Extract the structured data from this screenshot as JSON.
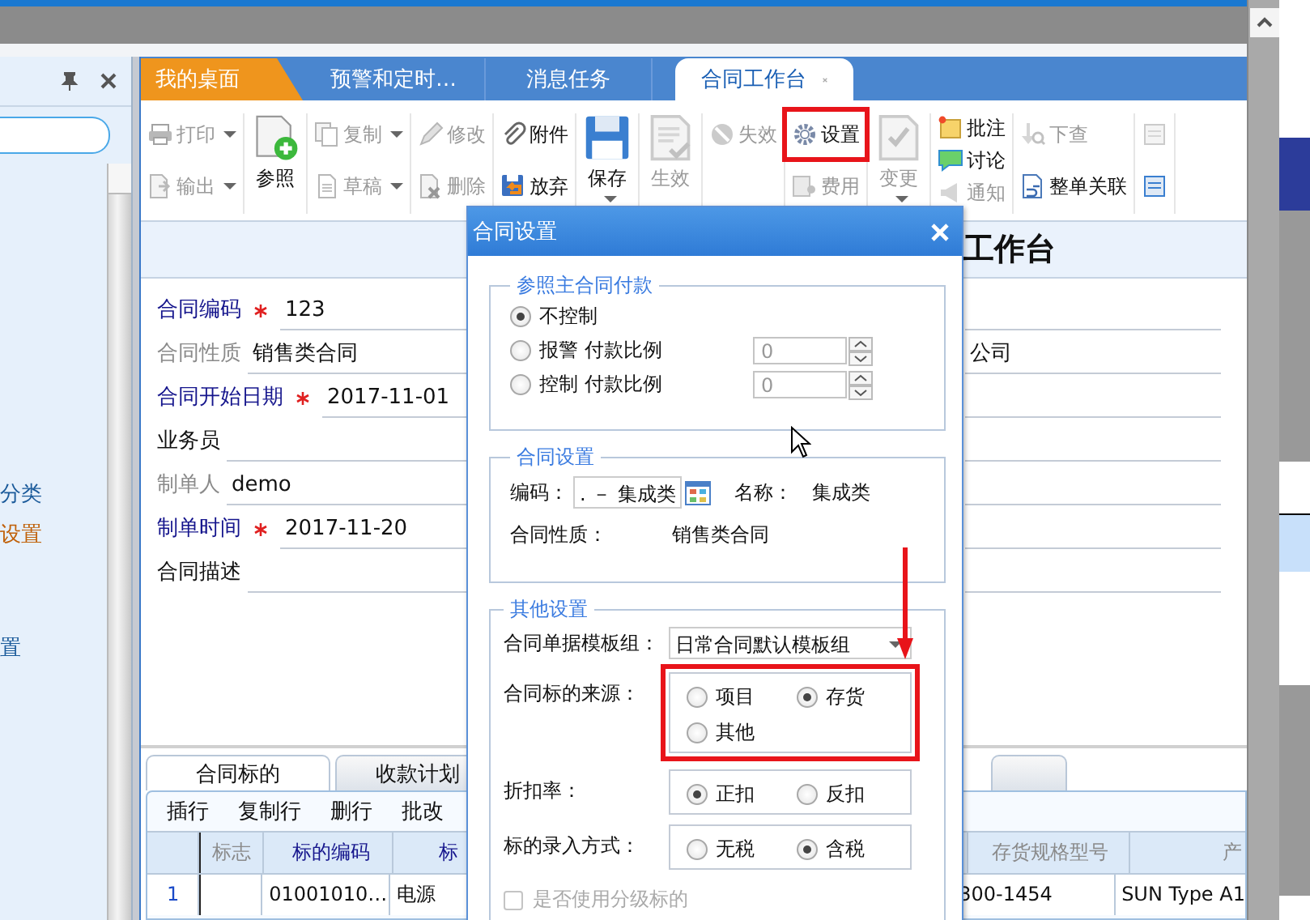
{
  "sidebar": {
    "items": [
      {
        "label": "分类",
        "kind": "link"
      },
      {
        "label": "设置",
        "kind": "current"
      },
      {
        "label": "置",
        "kind": "link"
      }
    ]
  },
  "tabs": [
    {
      "label": "我的桌面",
      "kind": "home",
      "selected": false
    },
    {
      "label": "预警和定时…",
      "kind": "normal",
      "selected": false
    },
    {
      "label": "消息任务",
      "kind": "normal",
      "selected": false
    },
    {
      "label": "合同工作台",
      "kind": "normal",
      "selected": true,
      "closable": true
    }
  ],
  "toolbar": {
    "groups": [
      {
        "large": false,
        "items": [
          {
            "label": "打印",
            "disabled": true,
            "dropdown": true
          },
          {
            "label": "输出",
            "disabled": true,
            "dropdown": true
          }
        ]
      },
      {
        "large": true,
        "items": [
          {
            "label": "参照",
            "disabled": false
          }
        ]
      },
      {
        "large": false,
        "items": [
          {
            "label": "复制",
            "disabled": true,
            "dropdown": true
          },
          {
            "label": "草稿",
            "disabled": true,
            "dropdown": true
          }
        ]
      },
      {
        "large": false,
        "items": [
          {
            "label": "修改",
            "disabled": true
          },
          {
            "label": "删除",
            "disabled": true
          }
        ]
      },
      {
        "large": false,
        "items": [
          {
            "label": "附件",
            "disabled": false
          },
          {
            "label": "放弃",
            "disabled": false
          }
        ]
      },
      {
        "large": true,
        "items": [
          {
            "label": "保存",
            "disabled": false,
            "dropdown": true
          }
        ]
      },
      {
        "large": true,
        "items": [
          {
            "label": "生效",
            "disabled": true
          }
        ]
      },
      {
        "large": false,
        "items": [
          {
            "label": "失效",
            "disabled": true
          }
        ]
      },
      {
        "large": false,
        "items": [
          {
            "label": "设置",
            "disabled": false,
            "highlighted": true
          },
          {
            "label": "费用",
            "disabled": true
          }
        ]
      },
      {
        "large": true,
        "items": [
          {
            "label": "变更",
            "disabled": true,
            "dropdown": true
          }
        ]
      },
      {
        "large": false,
        "items": [
          {
            "label": "批注",
            "disabled": false
          },
          {
            "label": "讨论",
            "disabled": false
          },
          {
            "label": "通知",
            "disabled": true
          }
        ]
      },
      {
        "large": false,
        "items": [
          {
            "label": "下查",
            "disabled": true
          },
          {
            "label": "整单关联",
            "disabled": false
          }
        ]
      },
      {
        "large": false,
        "items": [
          {
            "disabled": true
          },
          {
            "disabled": false
          }
        ]
      }
    ]
  },
  "page_title": "工作台",
  "form": {
    "fields": [
      {
        "label": "合同编码",
        "kind": "required",
        "value": "123"
      },
      {
        "label": "合同性质",
        "kind": "readonly",
        "value": "销售类合同",
        "right_value": "公司"
      },
      {
        "label": "合同开始日期",
        "kind": "required",
        "value": "2017-11-01"
      },
      {
        "label": "业务员",
        "kind": "normal"
      },
      {
        "label": "制单人",
        "kind": "readonly",
        "value": "demo"
      },
      {
        "label": "制单时间",
        "kind": "required",
        "value": "2017-11-20"
      },
      {
        "label": "合同描述",
        "kind": "normal"
      }
    ]
  },
  "detail_tabs": [
    {
      "label": "合同标的",
      "selected": true
    },
    {
      "label": "收款计划",
      "selected": false
    },
    {
      "selected": false
    }
  ],
  "detail_toolbar": [
    "插行",
    "复制行",
    "删行",
    "批改"
  ],
  "table": {
    "columns": [
      {
        "label": "标志",
        "kind": "plain"
      },
      {
        "label": "标的编码",
        "kind": "required"
      },
      {
        "label": "标",
        "kind": "required"
      },
      {
        "label": "存货规格型号",
        "kind": "plain"
      },
      {
        "label": "产",
        "kind": "plain"
      }
    ],
    "rows": [
      {
        "number": "1",
        "code": "01001010…",
        "name": "电源",
        "spec": "300-1454",
        "product": "SUN Type A1"
      }
    ]
  },
  "dialog": {
    "title": "合同设置",
    "payment": {
      "legend": "参照主合同付款",
      "options": [
        {
          "label": "不控制",
          "selected": true
        },
        {
          "label": "报警 付款比例",
          "selected": false,
          "amount": "0"
        },
        {
          "label": "控制 付款比例",
          "selected": false,
          "amount": "0"
        }
      ]
    },
    "contract": {
      "legend": "合同设置",
      "code_label": "编码：",
      "code_value": ". － 集成类",
      "name_label": "名称：",
      "name_value": "集成类",
      "type_label": "合同性质：",
      "type_value": "销售类合同"
    },
    "other": {
      "legend": "其他设置",
      "template_label": "合同单据模板组：",
      "template_value": "日常合同默认模板组",
      "radio_rows": [
        {
          "label": "合同标的来源：",
          "highlighted": true,
          "options": [
            {
              "label": "项目",
              "selected": false
            },
            {
              "label": "存货",
              "selected": true
            },
            {
              "label": "其他",
              "selected": false
            }
          ]
        },
        {
          "label": "折扣率：",
          "highlighted": false,
          "options": [
            {
              "label": "正扣",
              "selected": true
            },
            {
              "label": "反扣",
              "selected": false
            }
          ]
        },
        {
          "label": "标的录入方式：",
          "highlighted": false,
          "options": [
            {
              "label": "无税",
              "selected": false
            },
            {
              "label": "含税",
              "selected": true
            }
          ]
        }
      ],
      "checkbox": {
        "label": "是否使用分级标的",
        "checked": false,
        "disabled": true
      }
    }
  }
}
